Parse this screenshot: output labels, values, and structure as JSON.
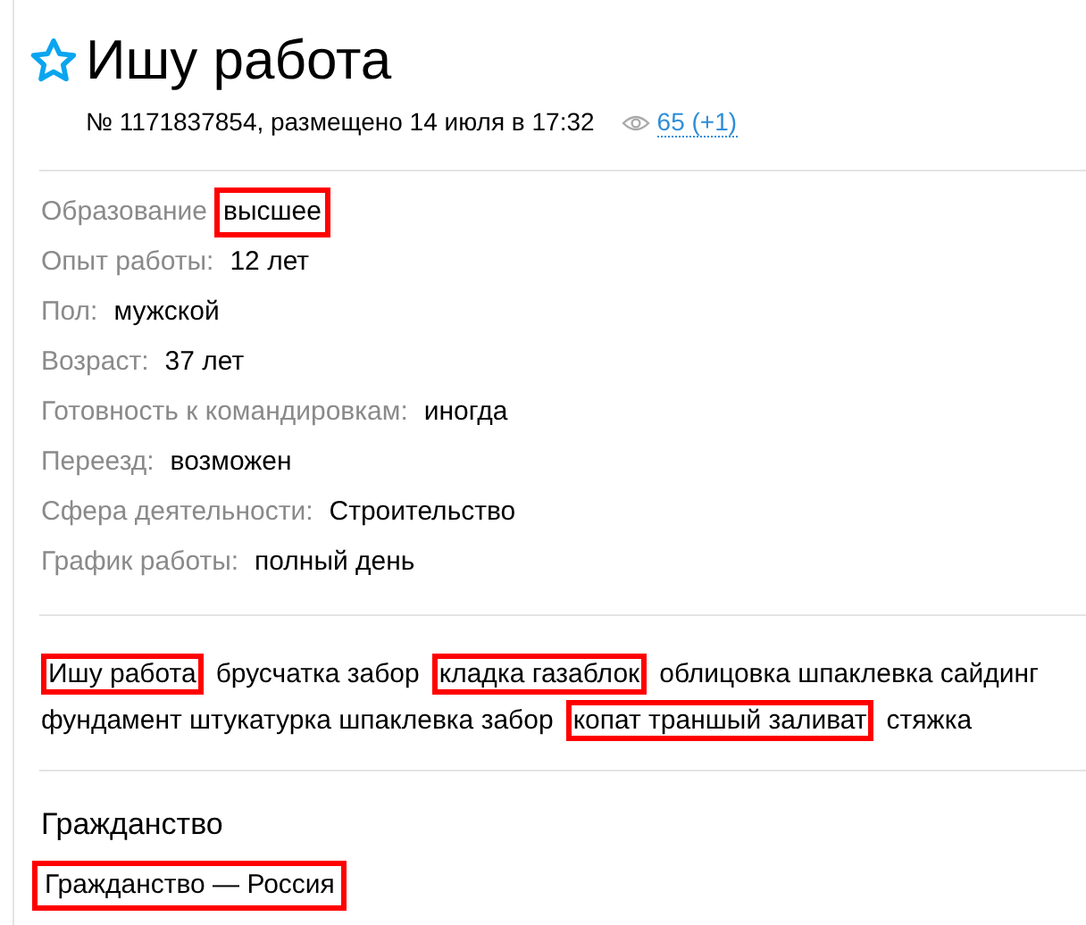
{
  "title": "Ишу работа",
  "favorite": false,
  "meta": {
    "info": "№ 1171837854, размещено 14 июля в 17:32",
    "views": "65 (+1)"
  },
  "details": [
    {
      "label": "Образование",
      "value": "высшее",
      "highlighted": true
    },
    {
      "label": "Опыт работы:",
      "value": "12 лет",
      "highlighted": false
    },
    {
      "label": "Пол:",
      "value": "мужской",
      "highlighted": false
    },
    {
      "label": "Возраст:",
      "value": "37 лет",
      "highlighted": false
    },
    {
      "label": "Готовность к командировкам:",
      "value": "иногда",
      "highlighted": false
    },
    {
      "label": "Переезд:",
      "value": "возможен",
      "highlighted": false
    },
    {
      "label": "Сфера деятельности:",
      "value": "Строительство",
      "highlighted": false
    },
    {
      "label": "График работы:",
      "value": "полный день",
      "highlighted": false
    }
  ],
  "description": [
    {
      "text": "Ишу работа",
      "highlighted": true
    },
    {
      "text": "брусчатка забор",
      "highlighted": false
    },
    {
      "text": "кладка газаблок",
      "highlighted": true
    },
    {
      "text": "облицовка шпаклевка сайдинг фундамент штукатурка шпаклевка забор",
      "highlighted": false
    },
    {
      "text": "копат траншый заливат",
      "highlighted": true
    },
    {
      "text": "стяжка",
      "highlighted": false
    }
  ],
  "citizenship": {
    "heading": "Гражданство",
    "value": "Гражданство — Россия",
    "highlighted": true
  }
}
